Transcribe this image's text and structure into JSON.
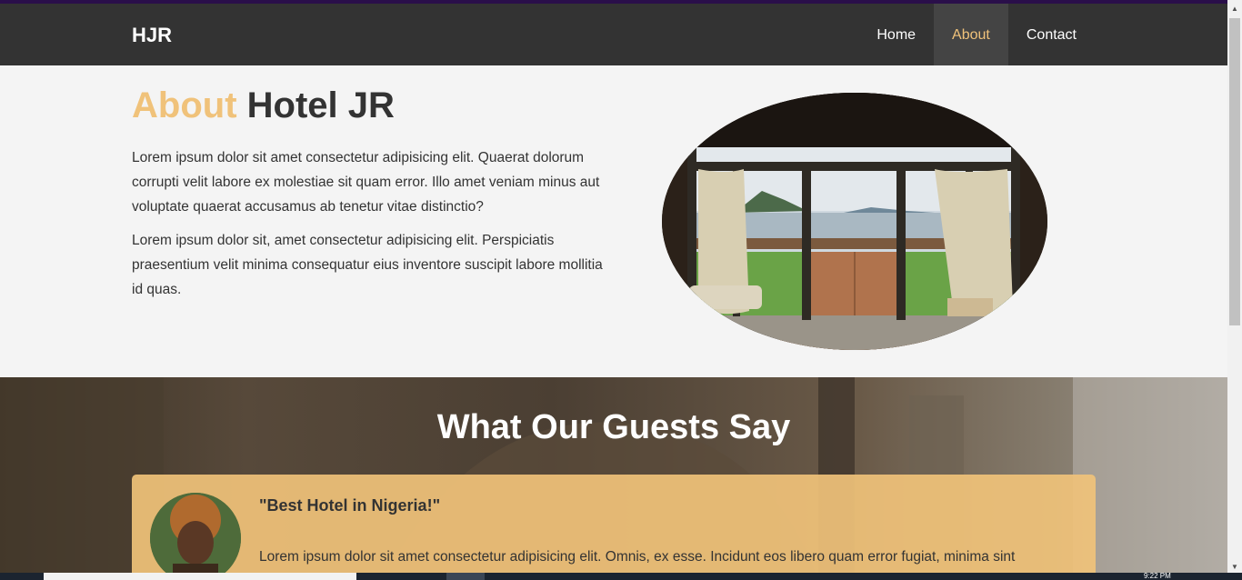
{
  "brand": "HJR",
  "nav": {
    "items": [
      "Home",
      "About",
      "Contact"
    ],
    "active": "About"
  },
  "about": {
    "title_accent": "About",
    "title_rest": "Hotel JR",
    "paragraphs": [
      "Lorem ipsum dolor sit amet consectetur adipisicing elit. Quaerat dolorum corrupti velit labore ex molestiae sit quam error. Illo amet veniam minus aut voluptate quaerat accusamus ab tenetur vitae distinctio?",
      "Lorem ipsum dolor sit, amet consectetur adipisicing elit. Perspiciatis praesentium velit minima consequatur eius inventore suscipit labore mollitia id quas."
    ]
  },
  "testimonials": {
    "title": "What Our Guests Say",
    "items": [
      {
        "quote": "\"Best Hotel in Nigeria!\"",
        "text": "Lorem ipsum dolor sit amet consectetur adipisicing elit. Omnis, ex esse. Incidunt eos libero quam error fugiat, minima sint"
      }
    ]
  },
  "taskbar": {
    "clock": "9:22 PM"
  },
  "colors": {
    "nav_bg": "#333333",
    "accent": "#f0c27a",
    "body_bg": "#f4f4f4",
    "card_bg": "#f0c27a",
    "top_accent": "#2a0f4a"
  }
}
